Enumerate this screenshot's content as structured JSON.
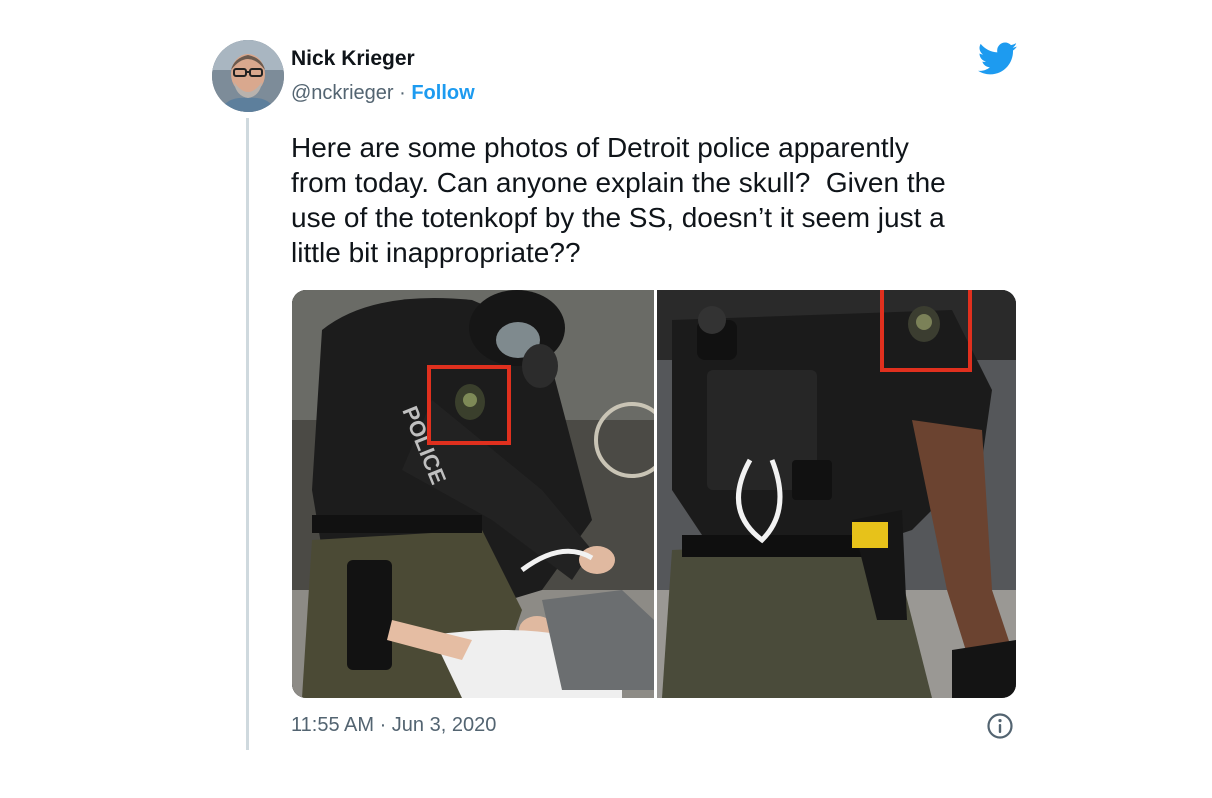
{
  "tweet": {
    "author": {
      "name": "Nick Krieger",
      "handle": "@nckrieger",
      "separator": " · ",
      "follow_label": "Follow",
      "avatar_icon": "user-avatar"
    },
    "text": "Here are some photos of Detroit police apparently\nfrom today. Can anyone explain the skull?  Given the\nuse of the totenkopf by the SS, doesn’t it seem just a\nlittle bit inappropriate??",
    "media": {
      "count": 2,
      "photos": [
        {
          "label": "photo-1",
          "highlight_color": "#e0301e",
          "patch_text": "POLICE"
        },
        {
          "label": "photo-2",
          "highlight_color": "#e0301e"
        }
      ]
    },
    "timestamp": "11:55 AM · Jun 3, 2020",
    "icons": {
      "brand": "twitter-bird-icon",
      "info": "info-icon"
    },
    "colors": {
      "brand_blue": "#1d9bf0",
      "secondary_text": "#536471",
      "primary_text": "#0f1419",
      "highlight_red": "#e0301e"
    }
  }
}
